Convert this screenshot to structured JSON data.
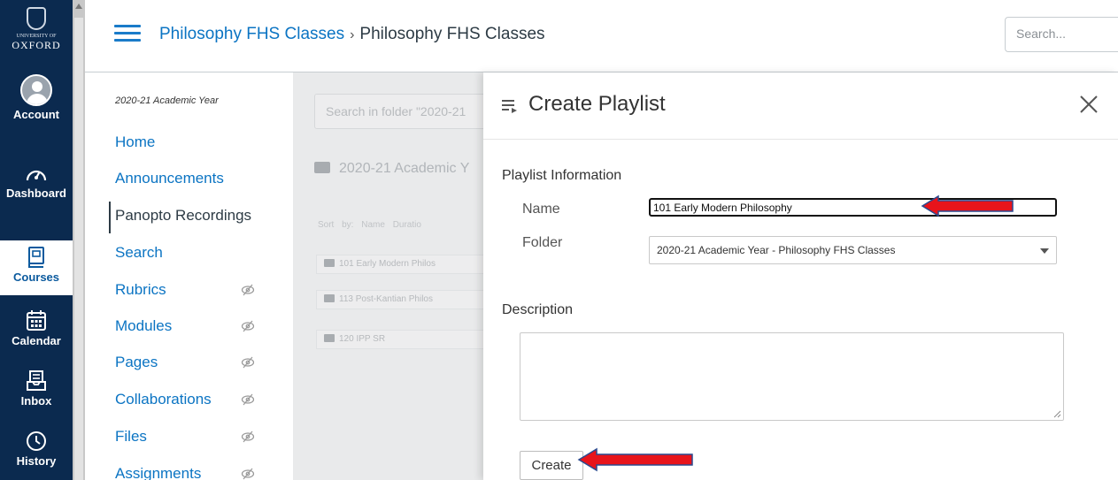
{
  "global_nav": {
    "logo": {
      "small": "UNIVERSITY OF",
      "big": "OXFORD"
    },
    "items": [
      {
        "label": "Account",
        "icon": "account-avatar-icon"
      },
      {
        "label": "Dashboard",
        "icon": "dashboard-gauge-icon"
      },
      {
        "label": "Courses",
        "icon": "courses-book-icon"
      },
      {
        "label": "Calendar",
        "icon": "calendar-icon"
      },
      {
        "label": "Inbox",
        "icon": "inbox-icon"
      },
      {
        "label": "History",
        "icon": "history-clock-icon"
      }
    ]
  },
  "header": {
    "breadcrumb_course": "Philosophy FHS Classes",
    "breadcrumb_separator": "›",
    "breadcrumb_current": "Philosophy FHS Classes",
    "search_placeholder": "Search..."
  },
  "course_nav": {
    "term": "2020-21 Academic Year",
    "items": [
      {
        "label": "Home",
        "hidden": false
      },
      {
        "label": "Announcements",
        "hidden": false
      },
      {
        "label": "Panopto Recordings",
        "hidden": false,
        "active": true
      },
      {
        "label": "Search",
        "hidden": false
      },
      {
        "label": "Rubrics",
        "hidden": true
      },
      {
        "label": "Modules",
        "hidden": true
      },
      {
        "label": "Pages",
        "hidden": true
      },
      {
        "label": "Collaborations",
        "hidden": true
      },
      {
        "label": "Files",
        "hidden": true
      },
      {
        "label": "Assignments",
        "hidden": true
      }
    ]
  },
  "panopto_background": {
    "folder_search_placeholder": "Search in folder \"2020-21",
    "folder_title": "2020-21 Academic Y",
    "sort_text": "Sort by: Name Duratio",
    "folders": [
      "101 Early Modern Philos",
      "113 Post-Kantian Philos",
      "120 IPP SR"
    ]
  },
  "dialog": {
    "title": "Create Playlist",
    "playlist_info_heading": "Playlist Information",
    "name_label": "Name",
    "name_value": "101 Early Modern Philosophy",
    "folder_label": "Folder",
    "folder_value": "2020-21 Academic Year - Philosophy FHS Classes",
    "description_heading": "Description",
    "description_value": "",
    "create_label": "Create"
  },
  "colors": {
    "nav_background": "#0b2a4f",
    "link_blue": "#0b74c3",
    "annotation_red": "#e8141b",
    "annotation_outline": "#2b4a8f"
  }
}
